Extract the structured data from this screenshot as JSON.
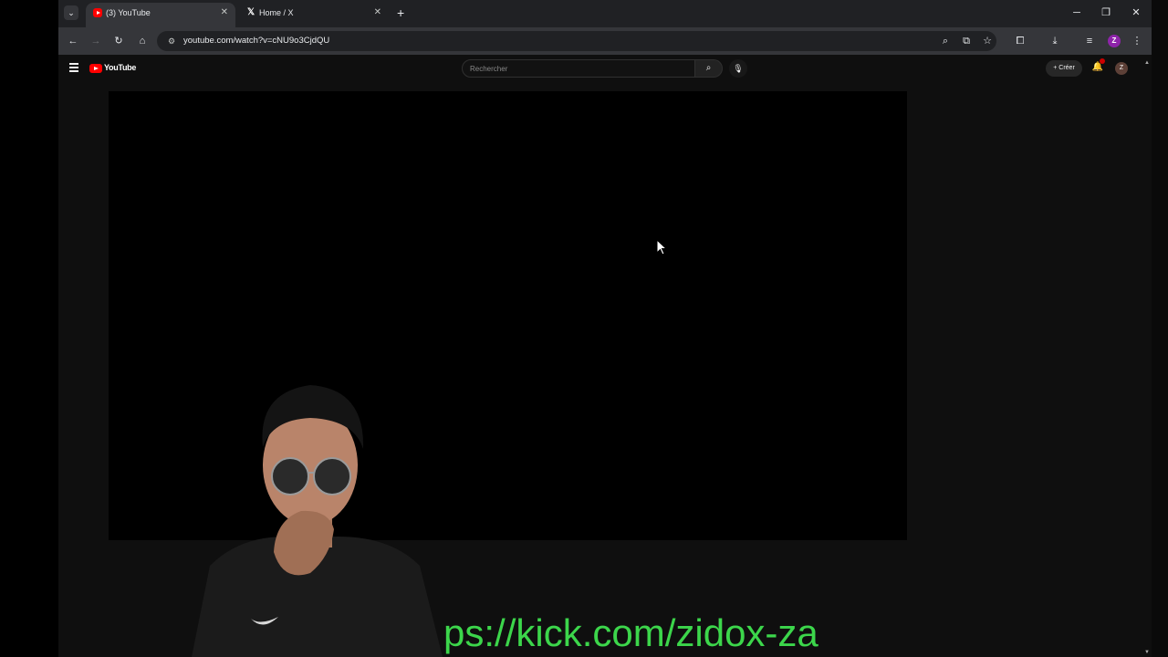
{
  "browser": {
    "tabs": [
      {
        "title": "(3) YouTube",
        "favicon": "youtube-icon",
        "active": true
      },
      {
        "title": "Home / X",
        "favicon": "x-icon",
        "active": false
      }
    ],
    "new_tab_label": "+",
    "close_glyph": "✕",
    "url": "youtube.com/watch?v=cNU9o3CjdQU",
    "profile_initial": "Z"
  },
  "youtube": {
    "logo_text": "YouTube",
    "search_placeholder": "Rechercher",
    "create_label": "Créer",
    "notification_count": "9+",
    "avatar_initial": "Z"
  },
  "overlay": {
    "stream_url": "ps://kick.com/zidox-za"
  },
  "colors": {
    "tab_strip": "#202124",
    "toolbar": "#35363a",
    "youtube_bg": "#0f0f0f",
    "youtube_red": "#ff0000",
    "overlay_text": "#3cd64b"
  }
}
